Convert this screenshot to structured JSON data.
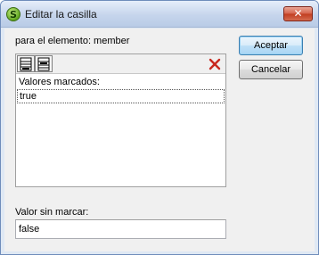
{
  "window": {
    "title": "Editar la casilla",
    "close_label": "✕"
  },
  "dialog": {
    "element_label": "para el elemento: member",
    "checked_values_header": "Valores marcados:",
    "checked_values": [
      "true"
    ],
    "unchecked_label": "Valor sin marcar:",
    "unchecked_value": "false"
  },
  "buttons": {
    "accept": "Aceptar",
    "cancel": "Cancelar"
  },
  "icons": {
    "app": "app-logo-icon",
    "append_row": "append-row-icon",
    "insert_row": "insert-row-icon",
    "delete": "delete-x-icon"
  },
  "colors": {
    "titlebar": "#c6d5ec",
    "close_button": "#c13d20",
    "delete_icon": "#c8281e",
    "default_button_border": "#3c7fb1"
  }
}
